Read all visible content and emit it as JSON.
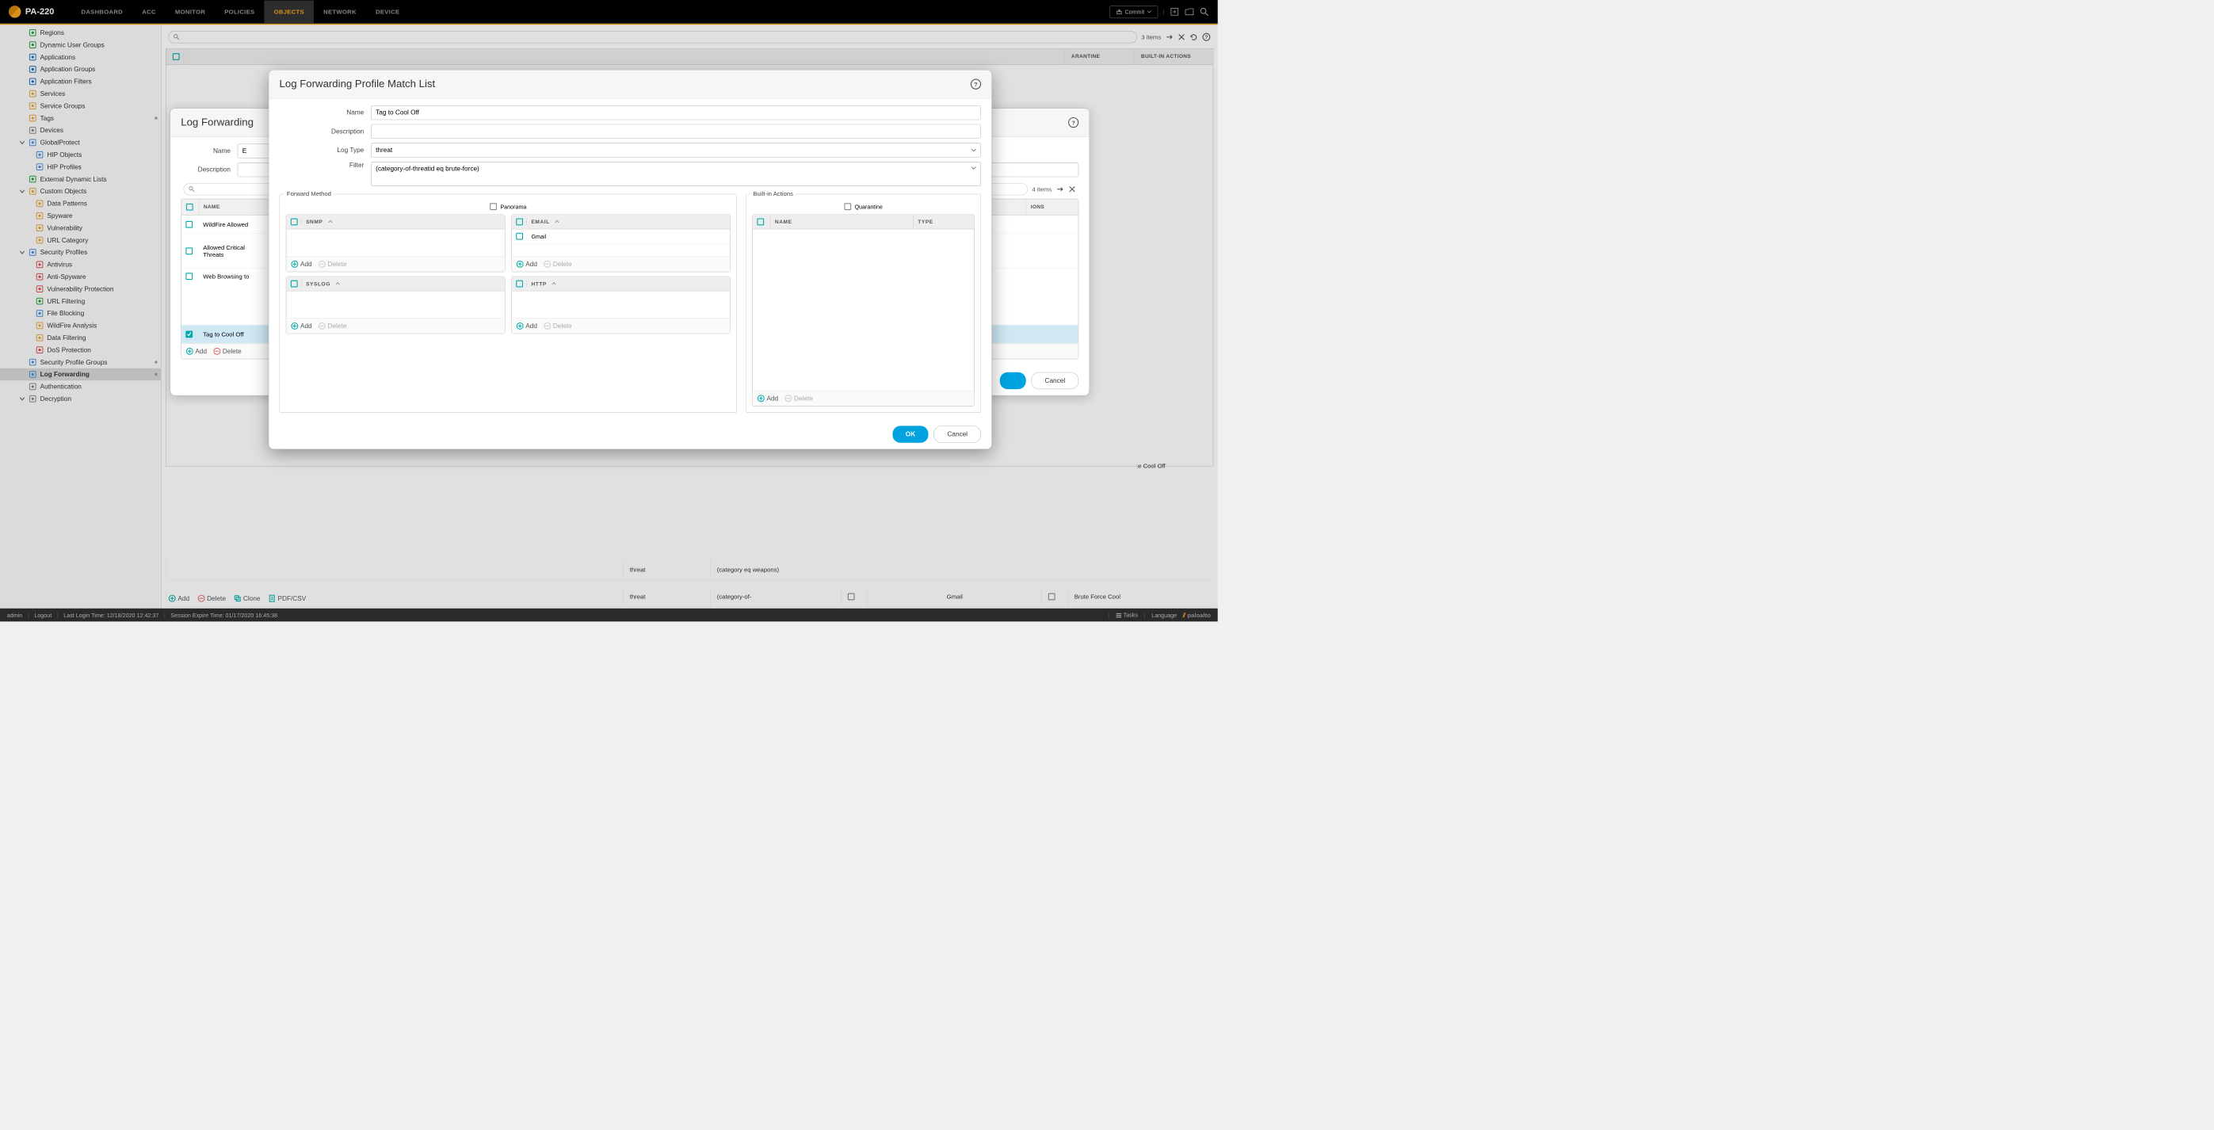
{
  "device": "PA-220",
  "topnav": {
    "items": [
      "DASHBOARD",
      "ACC",
      "MONITOR",
      "POLICIES",
      "OBJECTS",
      "NETWORK",
      "DEVICE"
    ],
    "active": 4,
    "commit": "Commit"
  },
  "sidebar": {
    "items": [
      {
        "label": "Regions",
        "level": 1,
        "icon": "globe",
        "color": "#2a9d3f"
      },
      {
        "label": "Dynamic User Groups",
        "level": 1,
        "icon": "users",
        "color": "#2a9d3f"
      },
      {
        "label": "Applications",
        "level": 1,
        "icon": "apps",
        "color": "#1e6fb8"
      },
      {
        "label": "Application Groups",
        "level": 1,
        "icon": "appgrp",
        "color": "#1e6fb8"
      },
      {
        "label": "Application Filters",
        "level": 1,
        "icon": "filter",
        "color": "#1e6fb8"
      },
      {
        "label": "Services",
        "level": 1,
        "icon": "gear",
        "color": "#e8a33d"
      },
      {
        "label": "Service Groups",
        "level": 1,
        "icon": "geargrp",
        "color": "#e8a33d"
      },
      {
        "label": "Tags",
        "level": 1,
        "icon": "tag",
        "color": "#e8a33d",
        "dot": true
      },
      {
        "label": "Devices",
        "level": 1,
        "icon": "device",
        "color": "#888"
      },
      {
        "label": "GlobalProtect",
        "level": 1,
        "icon": "shield",
        "color": "#4a90d9",
        "expandable": true
      },
      {
        "label": "HIP Objects",
        "level": 2,
        "icon": "hip",
        "color": "#4a90d9"
      },
      {
        "label": "HIP Profiles",
        "level": 2,
        "icon": "hip",
        "color": "#4a90d9"
      },
      {
        "label": "External Dynamic Lists",
        "level": 1,
        "icon": "list",
        "color": "#2a9d3f"
      },
      {
        "label": "Custom Objects",
        "level": 1,
        "icon": "custom",
        "color": "#e8a33d",
        "expandable": true
      },
      {
        "label": "Data Patterns",
        "level": 2,
        "icon": "data",
        "color": "#e8a33d"
      },
      {
        "label": "Spyware",
        "level": 2,
        "icon": "spy",
        "color": "#e8a33d"
      },
      {
        "label": "Vulnerability",
        "level": 2,
        "icon": "vuln",
        "color": "#e8a33d"
      },
      {
        "label": "URL Category",
        "level": 2,
        "icon": "url",
        "color": "#e8a33d"
      },
      {
        "label": "Security Profiles",
        "level": 1,
        "icon": "sec",
        "color": "#4a90d9",
        "expandable": true
      },
      {
        "label": "Antivirus",
        "level": 2,
        "icon": "av",
        "color": "#d9534f"
      },
      {
        "label": "Anti-Spyware",
        "level": 2,
        "icon": "asw",
        "color": "#d9534f"
      },
      {
        "label": "Vulnerability Protection",
        "level": 2,
        "icon": "vp",
        "color": "#d9534f"
      },
      {
        "label": "URL Filtering",
        "level": 2,
        "icon": "uf",
        "color": "#2a9d3f"
      },
      {
        "label": "File Blocking",
        "level": 2,
        "icon": "fb",
        "color": "#4a90d9"
      },
      {
        "label": "WildFire Analysis",
        "level": 2,
        "icon": "wf",
        "color": "#e8a33d"
      },
      {
        "label": "Data Filtering",
        "level": 2,
        "icon": "df",
        "color": "#e8a33d"
      },
      {
        "label": "DoS Protection",
        "level": 2,
        "icon": "dos",
        "color": "#d9534f"
      },
      {
        "label": "Security Profile Groups",
        "level": 1,
        "icon": "spg",
        "color": "#4a90d9",
        "dot": true
      },
      {
        "label": "Log Forwarding",
        "level": 1,
        "icon": "log",
        "color": "#4a90d9",
        "active": true,
        "dot": true
      },
      {
        "label": "Authentication",
        "level": 1,
        "icon": "auth",
        "color": "#888"
      },
      {
        "label": "Decryption",
        "level": 1,
        "icon": "decrypt",
        "color": "#888",
        "expandable": true
      }
    ]
  },
  "content": {
    "items_count": "4 items",
    "outer_items_count": "3 items",
    "headers": {
      "quarantine": "ARANTINE",
      "builtin": "BUILT-IN ACTIONS"
    },
    "rows": [
      {
        "type": "threat",
        "filter": "(category eq weapons)",
        "email": "",
        "ba": ""
      },
      {
        "type": "threat",
        "filter": "(category-of-",
        "email": "Gmail",
        "ba": "Brute Force Cool"
      }
    ],
    "cooloff_text": ":e Cool Off",
    "actions": {
      "add": "Add",
      "delete": "Delete",
      "clone": "Clone",
      "pdfcsv": "PDF/CSV"
    }
  },
  "modal1": {
    "title": "Log Forwarding",
    "name_label": "Name",
    "desc_label": "Description",
    "table": {
      "header_name": "NAME",
      "header_ba": "IONS",
      "rows": [
        {
          "name": "WildFire Allowed"
        },
        {
          "name": "Allowed Critical Threats",
          "name2": ""
        },
        {
          "name": "Web Browsing to"
        },
        {
          "name": "Tag to Cool Off",
          "selected": true
        }
      ]
    },
    "inner_items": "4 items",
    "add": "Add",
    "delete": "Delete",
    "cancel": "Cancel"
  },
  "modal2": {
    "title": "Log Forwarding Profile Match List",
    "labels": {
      "name": "Name",
      "description": "Description",
      "log_type": "Log Type",
      "filter": "Filter"
    },
    "values": {
      "name": "Tag to Cool Off",
      "description": "",
      "log_type": "threat",
      "filter": "(category-of-threatid eq brute-force)"
    },
    "forward_method": {
      "legend": "Forward Method",
      "panorama": "Panorama",
      "snmp_h": "SNMP",
      "email_h": "EMAIL",
      "email_row": "Gmail",
      "syslog_h": "SYSLOG",
      "http_h": "HTTP",
      "add": "Add",
      "delete": "Delete"
    },
    "builtin": {
      "legend": "Built-in Actions",
      "quarantine": "Quarantine",
      "name_h": "NAME",
      "type_h": "TYPE",
      "add": "Add",
      "delete": "Delete"
    },
    "ok": "OK",
    "cancel": "Cancel"
  },
  "footer": {
    "user": "admin",
    "logout": "Logout",
    "last_login": "Last Login Time: 12/18/2020 12:42:37",
    "expire": "Session Expire Time: 01/17/2020 16:45:38",
    "tasks": "Tasks",
    "language": "Language",
    "brand": "paloalto"
  }
}
